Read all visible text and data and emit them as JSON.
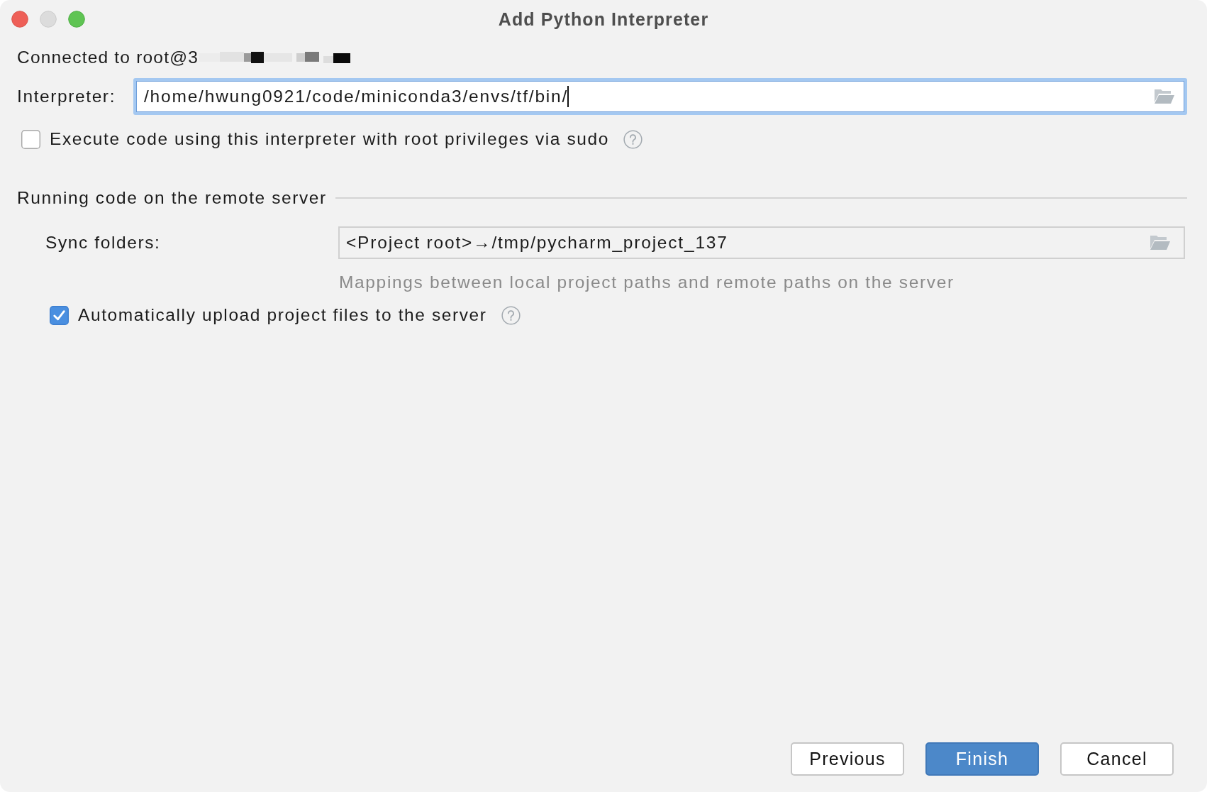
{
  "window": {
    "title": "Add Python Interpreter",
    "controls": [
      {
        "kind": "close",
        "disabled": false
      },
      {
        "kind": "minimize",
        "disabled": true
      },
      {
        "kind": "zoom",
        "disabled": false
      }
    ]
  },
  "connection": {
    "label": "Connected to root@3",
    "host_redacted": true
  },
  "interpreter": {
    "label": "Interpreter:",
    "value": "/home/hwung0921/code/miniconda3/envs/tf/bin/",
    "focused": true
  },
  "sudo_option": {
    "label": "Execute code using this interpreter with root privileges via sudo",
    "checked": false
  },
  "remote_section": {
    "title": "Running code on the remote server",
    "sync_folders": {
      "label": "Sync folders:",
      "value": "<Project root>→/tmp/pycharm_project_137",
      "hint": "Mappings between local project paths and remote paths on the server"
    },
    "auto_upload": {
      "label": "Automatically upload project files to the server",
      "checked": true
    }
  },
  "buttons": [
    {
      "label": "Previous",
      "kind": "default"
    },
    {
      "label": "Finish",
      "kind": "primary"
    },
    {
      "label": "Cancel",
      "kind": "default"
    }
  ]
}
